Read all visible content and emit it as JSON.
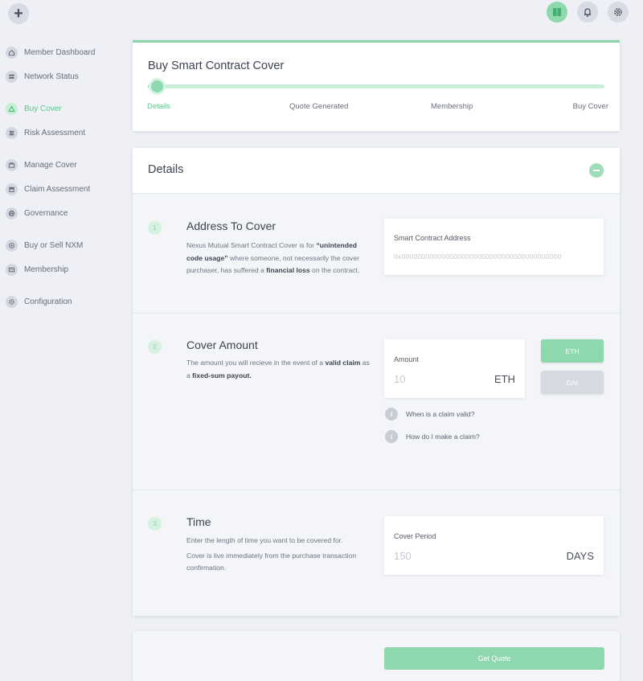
{
  "topbar": {
    "logo_glyph": "+",
    "icons": [
      "book-icon",
      "bell-icon",
      "gear-icon"
    ],
    "active_color": "#8fd8ad"
  },
  "sidebar": {
    "groups": [
      [
        {
          "label": "Member Dashboard",
          "icon": "home-icon"
        },
        {
          "label": "Network Status",
          "icon": "server-icon"
        }
      ],
      [
        {
          "label": "Buy Cover",
          "icon": "warning-triangle-icon",
          "active": true
        },
        {
          "label": "Risk Assessment",
          "icon": "stack-icon"
        }
      ],
      [
        {
          "label": "Manage Cover",
          "icon": "briefcase-icon"
        },
        {
          "label": "Claim Assessment",
          "icon": "archive-icon"
        },
        {
          "label": "Governance",
          "icon": "globe-icon"
        }
      ],
      [
        {
          "label": "Buy or Sell NXM",
          "icon": "coins-icon"
        },
        {
          "label": "Membership",
          "icon": "id-card-icon"
        }
      ],
      [
        {
          "label": "Configuration",
          "icon": "cog-icon"
        }
      ]
    ]
  },
  "header_card": {
    "title": "Buy Smart Contract Cover",
    "progress": 0.03,
    "steps": [
      "Details",
      "Quote Generated",
      "Membership",
      "Buy Cover"
    ],
    "active_step": 0
  },
  "details": {
    "title": "Details",
    "sections": [
      {
        "number": "1",
        "title": "Address To Cover",
        "desc_parts": [
          {
            "t": "Nexus Mutual Smart Contract Cover is for "
          },
          {
            "t": "“unintended code usage”",
            "b": true
          },
          {
            "t": " where someone, not necessarily the cover purchaser, has suffered a "
          },
          {
            "t": "financial loss",
            "b": true
          },
          {
            "t": " on the contract."
          }
        ],
        "field_label": "Smart Contract Address",
        "field_placeholder": "0x0000000000000000000000000000000000000000"
      },
      {
        "number": "2",
        "title": "Cover Amount",
        "desc_parts": [
          {
            "t": "The amount you will recieve in the event of a "
          },
          {
            "t": "valid claim",
            "b": true
          },
          {
            "t": " as a "
          },
          {
            "t": "fixed-sum payout.",
            "b": true
          }
        ],
        "field_label": "Amount",
        "field_placeholder": "10",
        "field_unit": "ETH",
        "currency_buttons": [
          "ETH",
          "DAI"
        ],
        "help_links": [
          "When is a claim valid?",
          "How do I make a claim?"
        ]
      },
      {
        "number": "3",
        "title": "Time",
        "desc_lines": [
          "Enter the length of time you want to be covered for.",
          "Cover is live immediately from the purchase transaction confirmation."
        ],
        "field_label": "Cover Period",
        "field_placeholder": "150",
        "field_unit": "DAYS"
      }
    ]
  },
  "footer": {
    "quote_button": "Get Quote"
  }
}
